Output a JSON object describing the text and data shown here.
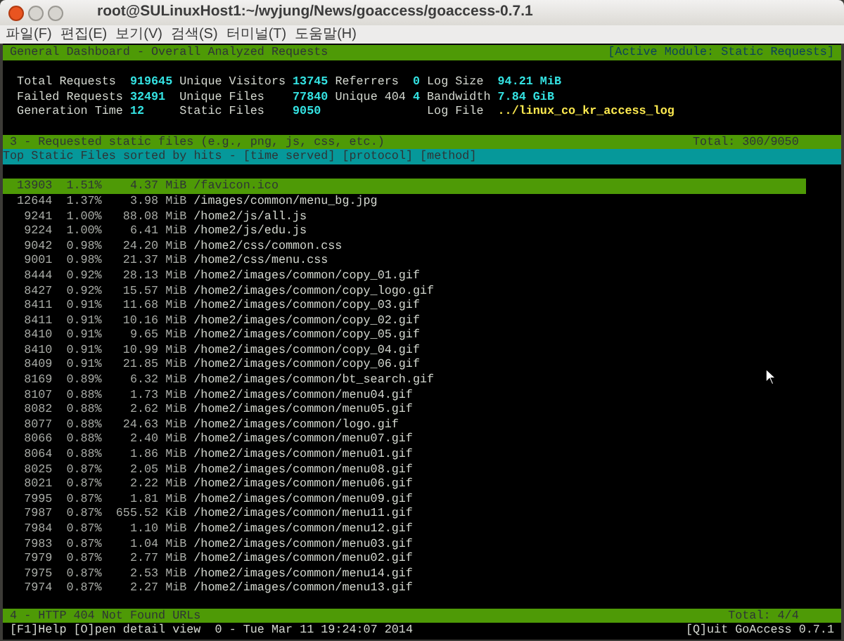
{
  "window": {
    "title": "root@SULinuxHost1:~/wyjung/News/goaccess/goaccess-0.7.1"
  },
  "menu": [
    "파일(F)",
    "편집(E)",
    "보기(V)",
    "검색(S)",
    "터미널(T)",
    "도움말(H)"
  ],
  "dashboard_header": {
    "title": "General Dashboard - Overall Analyzed Requests",
    "active_module": "[Active Module: Static Requests]"
  },
  "stats_columns": [
    {
      "items": [
        {
          "label": "Total Requests",
          "value": "919645",
          "kind": "number"
        },
        {
          "label": "Failed Requests",
          "value": "32491",
          "kind": "number"
        },
        {
          "label": "Generation Time",
          "value": "12",
          "kind": "number"
        }
      ]
    },
    {
      "items": [
        {
          "label": "Unique Visitors",
          "value": "13745",
          "kind": "number"
        },
        {
          "label": "Unique Files",
          "value": "77840",
          "kind": "number"
        },
        {
          "label": "Static Files",
          "value": "9050",
          "kind": "number"
        }
      ]
    },
    {
      "items": [
        {
          "label": "Referrers",
          "value": "0",
          "kind": "number"
        },
        {
          "label": "Unique 404",
          "value": "4",
          "kind": "number"
        }
      ]
    },
    {
      "items": [
        {
          "label": "Log Size",
          "value": "94.21 MiB",
          "kind": "number"
        },
        {
          "label": "Bandwidth",
          "value": "7.84 GiB",
          "kind": "number"
        },
        {
          "label": "Log File",
          "value": "../linux_co_kr_access_log",
          "kind": "file"
        }
      ]
    }
  ],
  "module": {
    "title": "3 - Requested static files (e.g., png, js, css, etc.)",
    "total": "Total: 300/9050",
    "subtitle": "Top Static Files sorted by hits - [time served] [protocol] [method]"
  },
  "rows": [
    {
      "hits": "13903",
      "percent": "1.51%",
      "size": "4.37",
      "unit": "MiB",
      "path": "/favicon.ico",
      "selected": true
    },
    {
      "hits": "12644",
      "percent": "1.37%",
      "size": "3.98",
      "unit": "MiB",
      "path": "/images/common/menu_bg.jpg",
      "selected": false
    },
    {
      "hits": "9241",
      "percent": "1.00%",
      "size": "88.08",
      "unit": "MiB",
      "path": "/home2/js/all.js",
      "selected": false
    },
    {
      "hits": "9224",
      "percent": "1.00%",
      "size": "6.41",
      "unit": "MiB",
      "path": "/home2/js/edu.js",
      "selected": false
    },
    {
      "hits": "9042",
      "percent": "0.98%",
      "size": "24.20",
      "unit": "MiB",
      "path": "/home2/css/common.css",
      "selected": false
    },
    {
      "hits": "9001",
      "percent": "0.98%",
      "size": "21.37",
      "unit": "MiB",
      "path": "/home2/css/menu.css",
      "selected": false
    },
    {
      "hits": "8444",
      "percent": "0.92%",
      "size": "28.13",
      "unit": "MiB",
      "path": "/home2/images/common/copy_01.gif",
      "selected": false
    },
    {
      "hits": "8427",
      "percent": "0.92%",
      "size": "15.57",
      "unit": "MiB",
      "path": "/home2/images/common/copy_logo.gif",
      "selected": false
    },
    {
      "hits": "8411",
      "percent": "0.91%",
      "size": "11.68",
      "unit": "MiB",
      "path": "/home2/images/common/copy_03.gif",
      "selected": false
    },
    {
      "hits": "8411",
      "percent": "0.91%",
      "size": "10.16",
      "unit": "MiB",
      "path": "/home2/images/common/copy_02.gif",
      "selected": false
    },
    {
      "hits": "8410",
      "percent": "0.91%",
      "size": "9.65",
      "unit": "MiB",
      "path": "/home2/images/common/copy_05.gif",
      "selected": false
    },
    {
      "hits": "8410",
      "percent": "0.91%",
      "size": "10.99",
      "unit": "MiB",
      "path": "/home2/images/common/copy_04.gif",
      "selected": false
    },
    {
      "hits": "8409",
      "percent": "0.91%",
      "size": "21.85",
      "unit": "MiB",
      "path": "/home2/images/common/copy_06.gif",
      "selected": false
    },
    {
      "hits": "8169",
      "percent": "0.89%",
      "size": "6.32",
      "unit": "MiB",
      "path": "/home2/images/common/bt_search.gif",
      "selected": false
    },
    {
      "hits": "8107",
      "percent": "0.88%",
      "size": "1.73",
      "unit": "MiB",
      "path": "/home2/images/common/menu04.gif",
      "selected": false
    },
    {
      "hits": "8082",
      "percent": "0.88%",
      "size": "2.62",
      "unit": "MiB",
      "path": "/home2/images/common/menu05.gif",
      "selected": false
    },
    {
      "hits": "8077",
      "percent": "0.88%",
      "size": "24.63",
      "unit": "MiB",
      "path": "/home2/images/common/logo.gif",
      "selected": false
    },
    {
      "hits": "8066",
      "percent": "0.88%",
      "size": "2.40",
      "unit": "MiB",
      "path": "/home2/images/common/menu07.gif",
      "selected": false
    },
    {
      "hits": "8064",
      "percent": "0.88%",
      "size": "1.86",
      "unit": "MiB",
      "path": "/home2/images/common/menu01.gif",
      "selected": false
    },
    {
      "hits": "8025",
      "percent": "0.87%",
      "size": "2.05",
      "unit": "MiB",
      "path": "/home2/images/common/menu08.gif",
      "selected": false
    },
    {
      "hits": "8021",
      "percent": "0.87%",
      "size": "2.22",
      "unit": "MiB",
      "path": "/home2/images/common/menu06.gif",
      "selected": false
    },
    {
      "hits": "7995",
      "percent": "0.87%",
      "size": "1.81",
      "unit": "MiB",
      "path": "/home2/images/common/menu09.gif",
      "selected": false
    },
    {
      "hits": "7987",
      "percent": "0.87%",
      "size": "655.52",
      "unit": "KiB",
      "path": "/home2/images/common/menu11.gif",
      "selected": false
    },
    {
      "hits": "7984",
      "percent": "0.87%",
      "size": "1.10",
      "unit": "MiB",
      "path": "/home2/images/common/menu12.gif",
      "selected": false
    },
    {
      "hits": "7983",
      "percent": "0.87%",
      "size": "1.04",
      "unit": "MiB",
      "path": "/home2/images/common/menu03.gif",
      "selected": false
    },
    {
      "hits": "7979",
      "percent": "0.87%",
      "size": "2.77",
      "unit": "MiB",
      "path": "/home2/images/common/menu02.gif",
      "selected": false
    },
    {
      "hits": "7975",
      "percent": "0.87%",
      "size": "2.53",
      "unit": "MiB",
      "path": "/home2/images/common/menu14.gif",
      "selected": false
    },
    {
      "hits": "7974",
      "percent": "0.87%",
      "size": "2.27",
      "unit": "MiB",
      "path": "/home2/images/common/menu13.gif",
      "selected": false
    }
  ],
  "next_module": {
    "title": "4 - HTTP 404 Not Found URLs",
    "total": "Total: 4/4"
  },
  "status_bar": {
    "left": "[F1]Help [O]pen detail view  0 - Tue Mar 11 19:24:07 2014",
    "right": "[Q]uit GoAccess 0.7.1"
  }
}
